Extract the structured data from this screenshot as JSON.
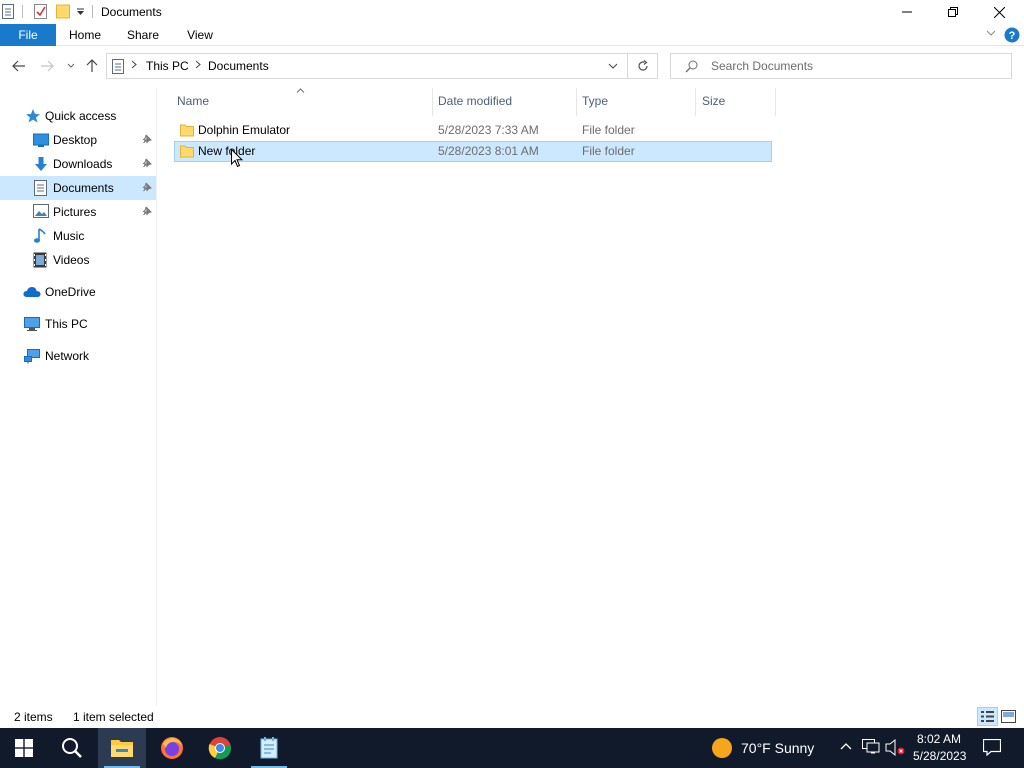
{
  "window": {
    "title": "Documents"
  },
  "ribbon": {
    "tabs": [
      "File",
      "Home",
      "Share",
      "View"
    ]
  },
  "address": {
    "crumbs": [
      "This PC",
      "Documents"
    ]
  },
  "search": {
    "placeholder": "Search Documents"
  },
  "sidebar": {
    "items": [
      {
        "label": "Quick access",
        "icon": "star-icon"
      },
      {
        "label": "Desktop",
        "icon": "desktop-icon",
        "pinned": true
      },
      {
        "label": "Downloads",
        "icon": "download-icon",
        "pinned": true
      },
      {
        "label": "Documents",
        "icon": "documents-icon",
        "pinned": true,
        "selected": true
      },
      {
        "label": "Pictures",
        "icon": "pictures-icon",
        "pinned": true
      },
      {
        "label": "Music",
        "icon": "music-icon"
      },
      {
        "label": "Videos",
        "icon": "videos-icon"
      },
      {
        "label": "OneDrive",
        "icon": "cloud-icon"
      },
      {
        "label": "This PC",
        "icon": "computer-icon"
      },
      {
        "label": "Network",
        "icon": "network-icon"
      }
    ]
  },
  "columns": [
    "Name",
    "Date modified",
    "Type",
    "Size"
  ],
  "files": [
    {
      "name": "Dolphin Emulator",
      "date": "5/28/2023 7:33 AM",
      "type": "File folder",
      "size": ""
    },
    {
      "name": "New folder",
      "date": "5/28/2023 8:01 AM",
      "type": "File folder",
      "size": "",
      "selected": true
    }
  ],
  "status": {
    "count": "2 items",
    "selection": "1 item selected"
  },
  "taskbar": {
    "weather": "70°F  Sunny",
    "time": "8:02 AM",
    "date": "5/28/2023"
  },
  "colors": {
    "accent": "#1979ca",
    "selection": "#cce8ff",
    "taskbar": "#101a2b"
  }
}
